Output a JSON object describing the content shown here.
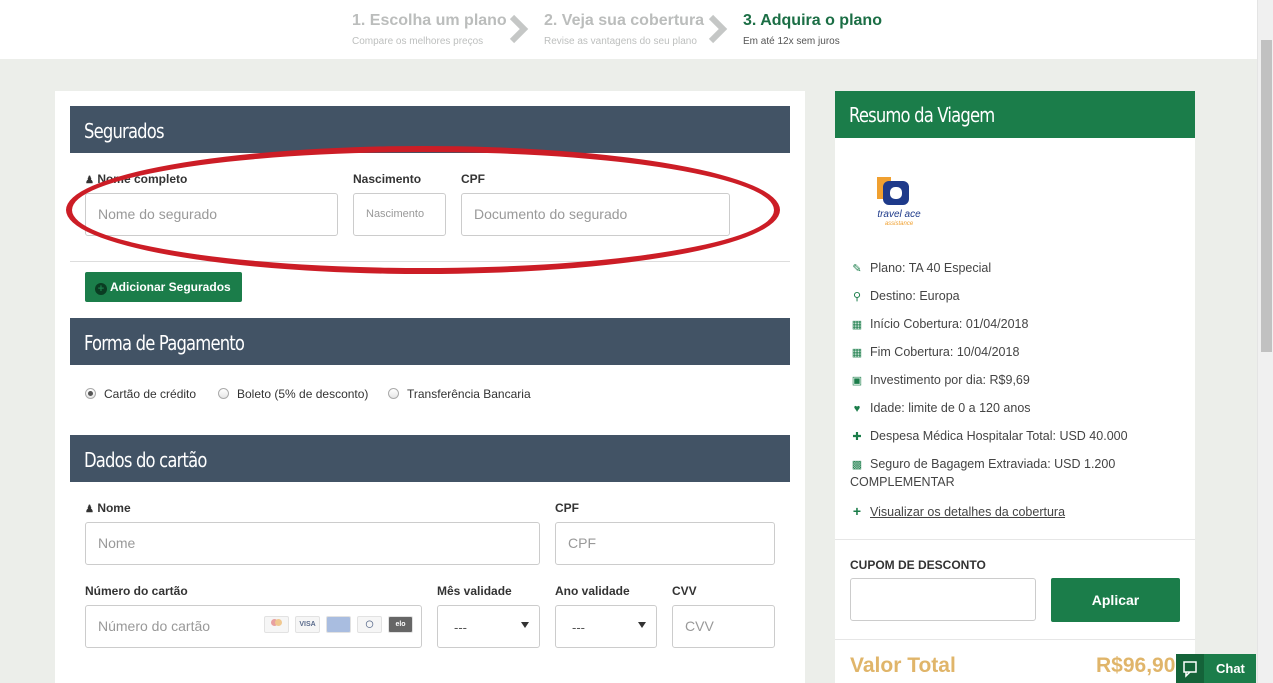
{
  "steps": [
    {
      "title": "1. Escolha um plano",
      "subtitle": "Compare os melhores preços"
    },
    {
      "title": "2. Veja sua cobertura",
      "subtitle": "Revise as vantagens do seu plano"
    },
    {
      "title": "3. Adquira o plano",
      "subtitle": "Em até 12x sem juros"
    }
  ],
  "segurados": {
    "title": "Segurados",
    "nome_label": "Nome completo",
    "nome_placeholder": "Nome do segurado",
    "nascimento_label": "Nascimento",
    "nascimento_placeholder": "Nascimento",
    "cpf_label": "CPF",
    "cpf_placeholder": "Documento do segurado",
    "add_button": "Adicionar Segurados"
  },
  "pagamento": {
    "title": "Forma de Pagamento",
    "options": [
      "Cartão de crédito",
      "Boleto (5% de desconto)",
      "Transferência Bancaria"
    ],
    "selected": "Cartão de crédito"
  },
  "cartao": {
    "title": "Dados do cartão",
    "nome_label": "Nome",
    "nome_placeholder": "Nome",
    "cpf_label": "CPF",
    "cpf_placeholder": "CPF",
    "numero_label": "Número do cartão",
    "numero_placeholder": "Número do cartão",
    "mes_label": "Mês validade",
    "mes_value": "---",
    "ano_label": "Ano validade",
    "ano_value": "---",
    "cvv_label": "CVV",
    "cvv_placeholder": "CVV",
    "card_brands": [
      "mastercard",
      "VISA",
      "AMEX",
      "diners",
      "elo"
    ]
  },
  "resumo": {
    "title": "Resumo da Viagem",
    "logo_text": "travel ace",
    "logo_sub": "assistance",
    "items": [
      {
        "icon": "ticket-icon",
        "text": "Plano: TA 40 Especial"
      },
      {
        "icon": "map-marker-icon",
        "text": "Destino: Europa"
      },
      {
        "icon": "calendar-icon",
        "text": "Início Cobertura: 01/04/2018"
      },
      {
        "icon": "calendar-icon",
        "text": "Fim Cobertura: 10/04/2018"
      },
      {
        "icon": "money-icon",
        "text": "Investimento por dia: R$9,69"
      },
      {
        "icon": "heart-icon",
        "text": "Idade: limite de 0 a 120 anos"
      },
      {
        "icon": "medkit-icon",
        "text": "Despesa Médica Hospitalar Total: USD 40.000"
      },
      {
        "icon": "suitcase-icon",
        "text": "Seguro de Bagagem Extraviada: USD 1.200"
      },
      {
        "icon": "",
        "text": "COMPLEMENTAR"
      }
    ],
    "details_link": "Visualizar os detalhes da cobertura",
    "coupon_label": "CUPOM DE DESCONTO",
    "apply_button": "Aplicar",
    "total_label": "Valor Total",
    "total_value": "R$96,90"
  },
  "chat": {
    "label": "Chat"
  },
  "colors": {
    "green": "#1b7d4a",
    "slate": "#425365",
    "gold": "#e0b56a",
    "annotation_red": "#cc1d26"
  }
}
